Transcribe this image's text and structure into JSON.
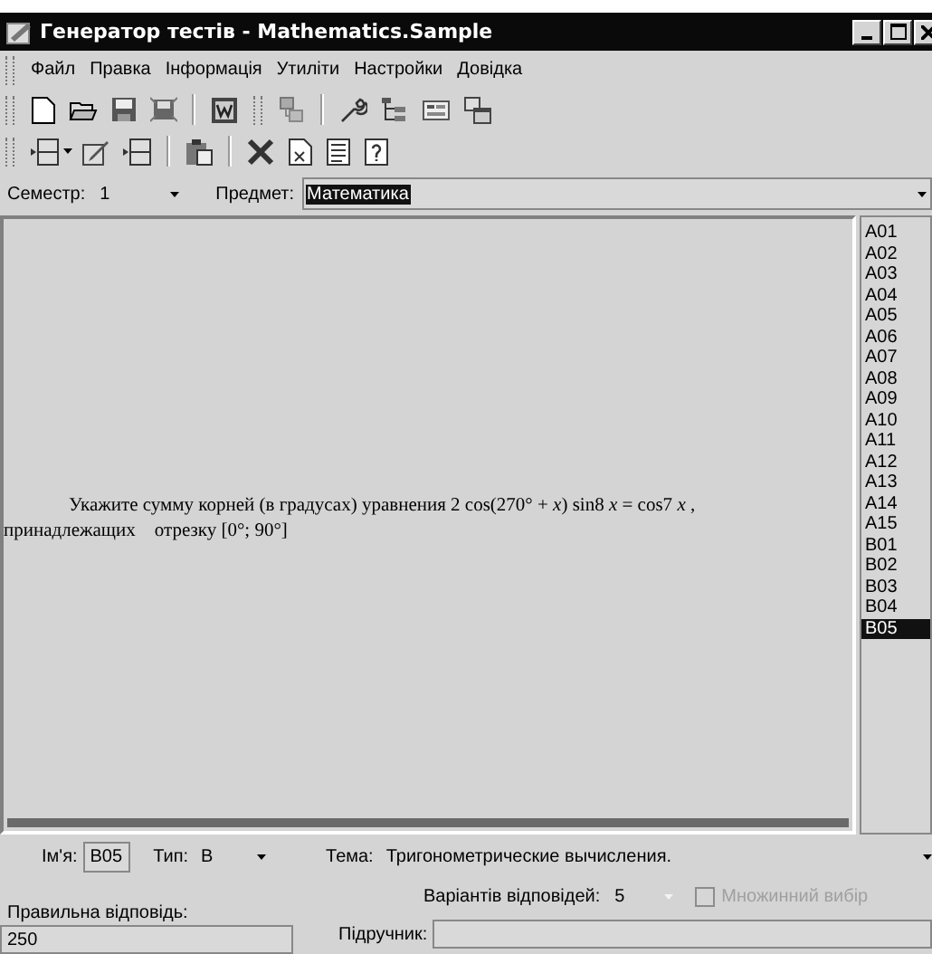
{
  "window": {
    "title": "Генератор тестів - Mathematics.Sample"
  },
  "menu": [
    "Файл",
    "Правка",
    "Інформація",
    "Утиліти",
    "Настройки",
    "Довідка"
  ],
  "semester": {
    "label": "Семестр:",
    "value": "1"
  },
  "subject": {
    "label": "Предмет:",
    "value": "Математика"
  },
  "question": {
    "lines": [
      "Укажите сумму корней (в градусах) уравнения 2 cos(270° + *x*) sin8 *x* = cos7 *x* ,",
      "принадлежащих    отрезку [0°; 90°]"
    ]
  },
  "items": [
    {
      "label": "A01",
      "selected": false
    },
    {
      "label": "A02",
      "selected": false
    },
    {
      "label": "A03",
      "selected": false
    },
    {
      "label": "A04",
      "selected": false
    },
    {
      "label": "A05",
      "selected": false
    },
    {
      "label": "A06",
      "selected": false
    },
    {
      "label": "A07",
      "selected": false
    },
    {
      "label": "A08",
      "selected": false
    },
    {
      "label": "A09",
      "selected": false
    },
    {
      "label": "A10",
      "selected": false
    },
    {
      "label": "A11",
      "selected": false
    },
    {
      "label": "A12",
      "selected": false
    },
    {
      "label": "A13",
      "selected": false
    },
    {
      "label": "A14",
      "selected": false
    },
    {
      "label": "A15",
      "selected": false
    },
    {
      "label": "B01",
      "selected": false
    },
    {
      "label": "B02",
      "selected": false
    },
    {
      "label": "B03",
      "selected": false
    },
    {
      "label": "B04",
      "selected": false
    },
    {
      "label": "B05",
      "selected": true
    }
  ],
  "details": {
    "name_label": "Ім'я:",
    "name_value": "B05",
    "type_label": "Тип:",
    "type_value": "B",
    "topic_label": "Тема:",
    "topic_value": "Тригонометрические вычисления.",
    "answer_label": "Правильна відповідь:",
    "answer_value": "250",
    "variants_label": "Варіантів відповідей:",
    "variants_value": "5",
    "variants_disabled": true,
    "multiple": {
      "label": "Множинний вибір",
      "checked": false,
      "disabled": true
    },
    "textbook_label": "Підручник:"
  }
}
